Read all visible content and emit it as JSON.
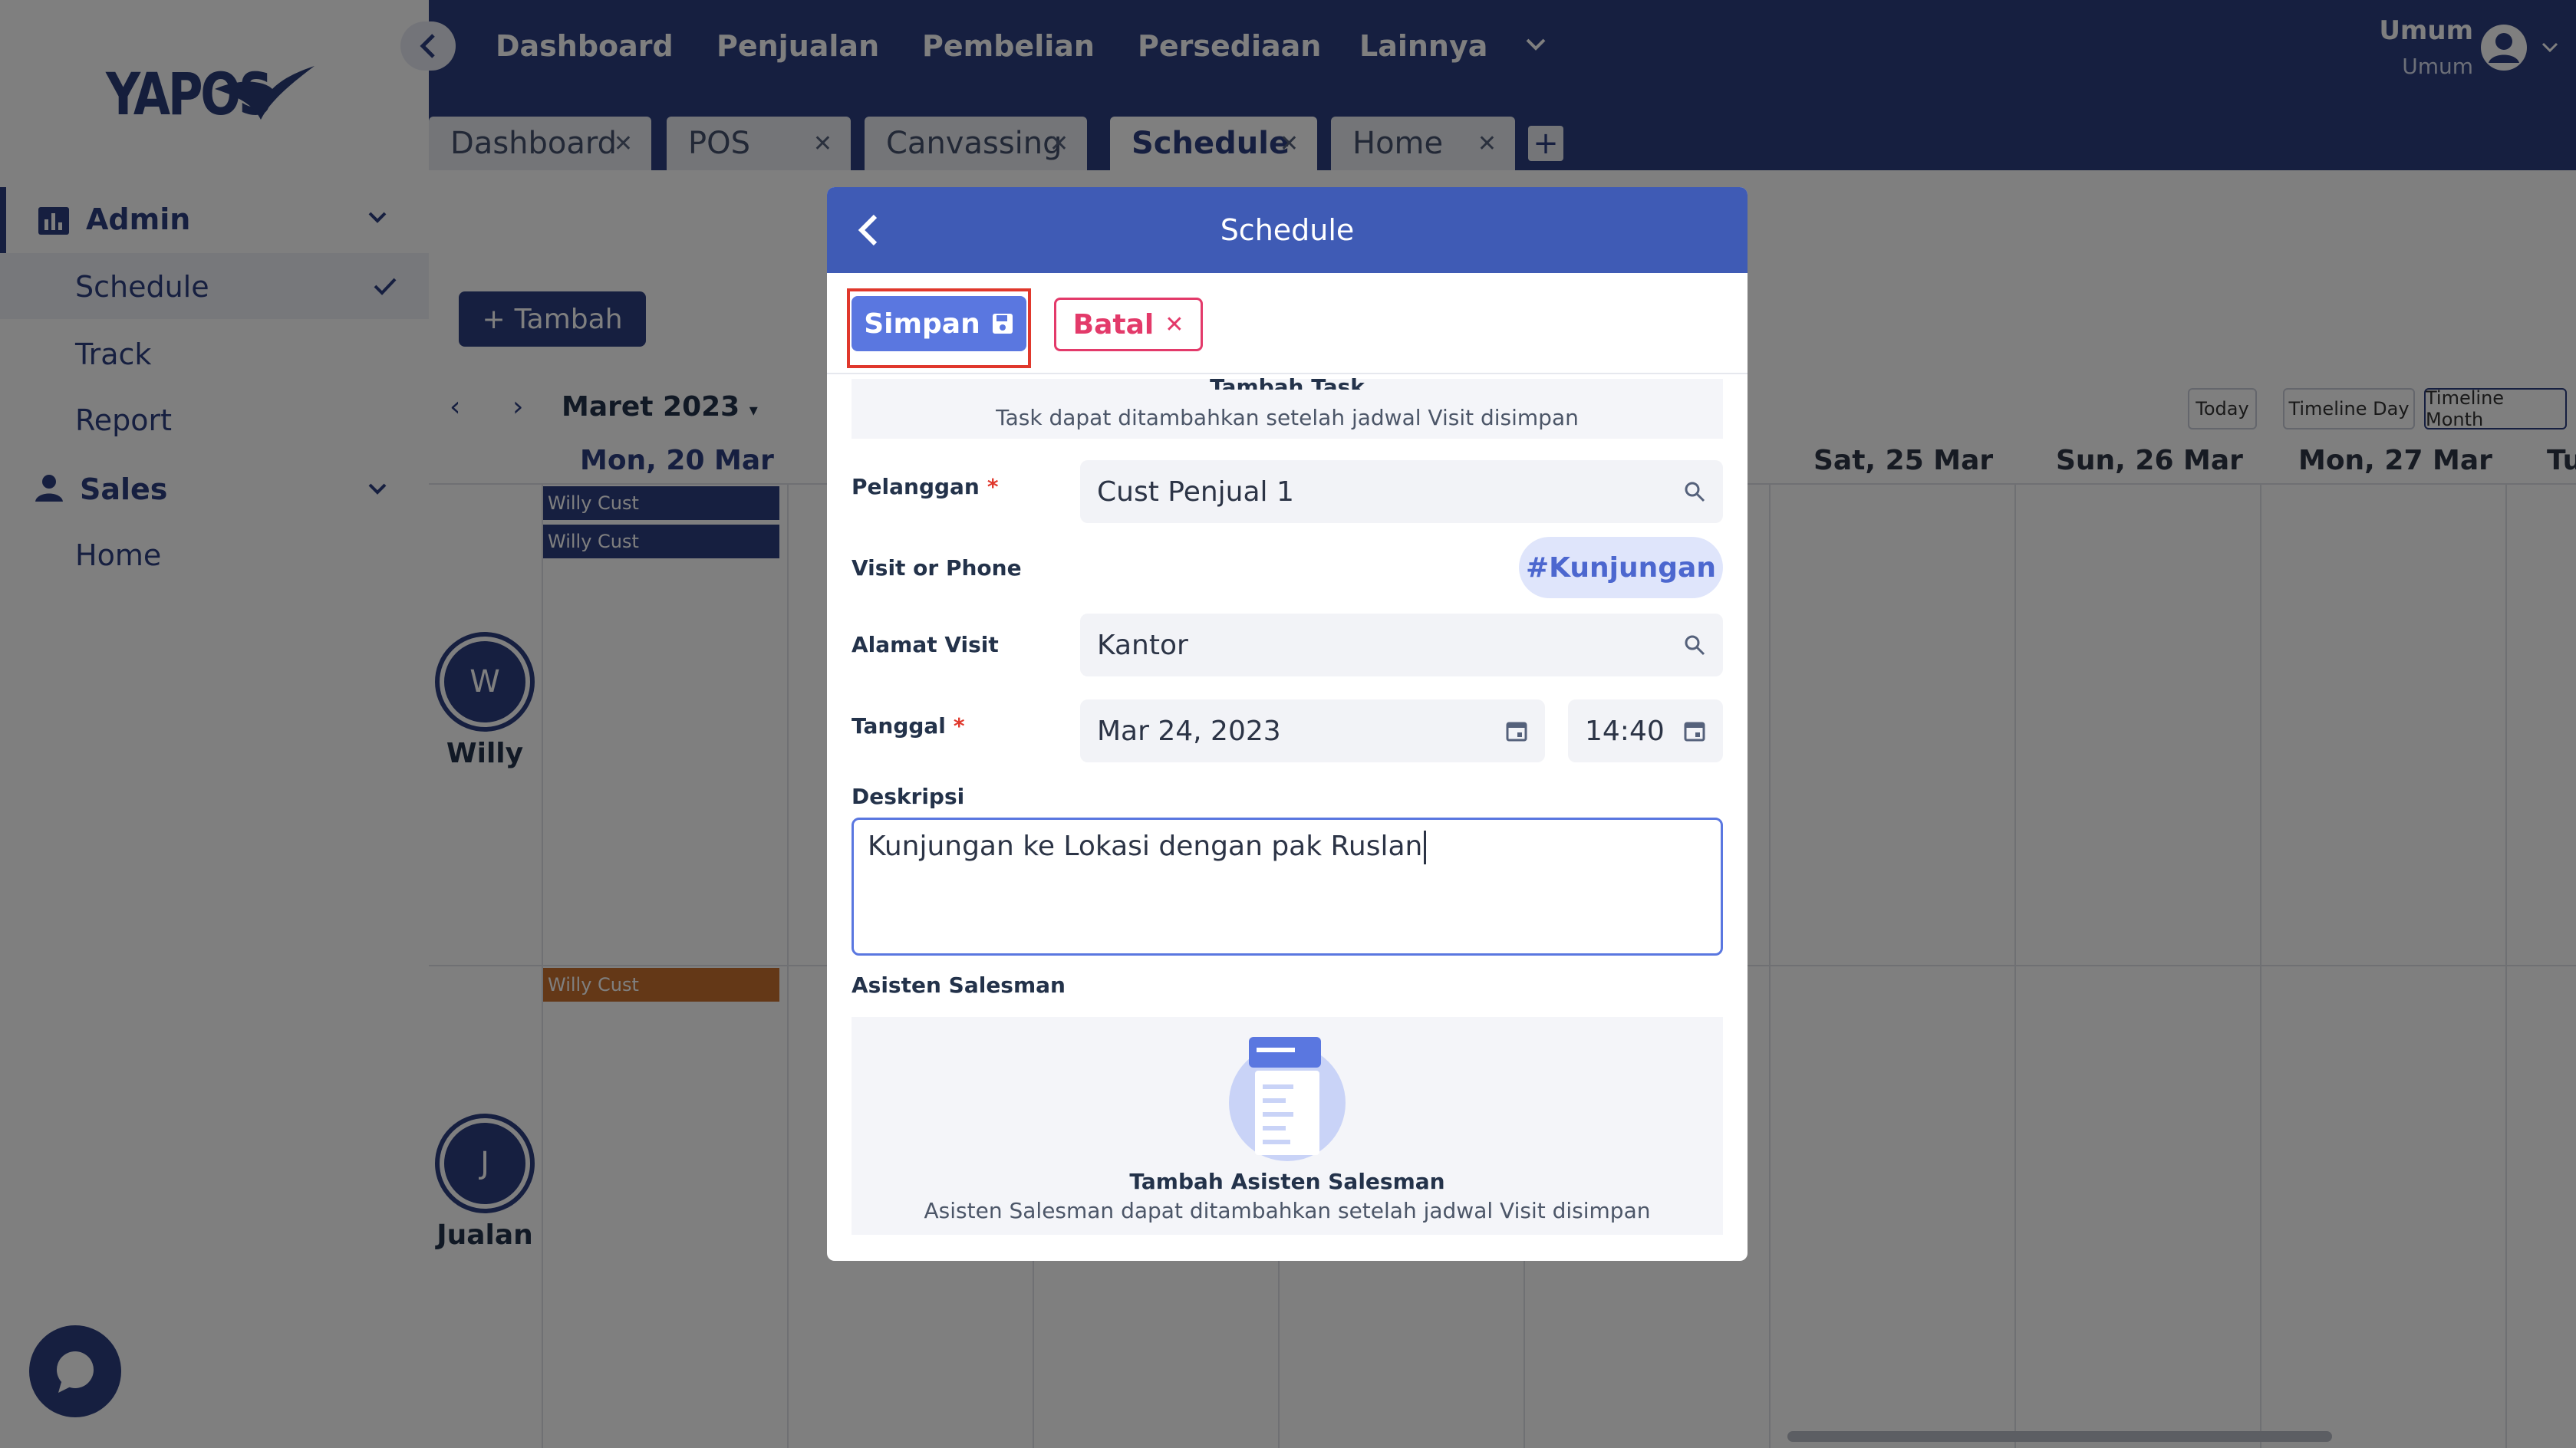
{
  "sidebar": {
    "logo_text": "YAPOS",
    "groups": [
      {
        "label": "Admin",
        "items": [
          "Schedule",
          "Track",
          "Report"
        ]
      },
      {
        "label": "Sales",
        "items": [
          "Home"
        ]
      }
    ],
    "active_item": "Schedule"
  },
  "topbar": {
    "menu": [
      "Dashboard",
      "Penjualan",
      "Pembelian",
      "Persediaan",
      "Lainnya"
    ],
    "user_name": "Umum",
    "user_role": "Umum"
  },
  "tabs": [
    "Dashboard",
    "POS",
    "Canvassing",
    "Schedule",
    "Home"
  ],
  "active_tab": "Schedule",
  "calendar": {
    "add_button": "Tambah",
    "month": "Maret 2023",
    "views": [
      "Today",
      "Timeline Day",
      "Timeline Month"
    ],
    "days": [
      "Mon, 20 Mar",
      "Sat, 25 Mar",
      "Sun, 26 Mar",
      "Mon, 27 Mar",
      "Tu"
    ],
    "events": [
      "Willy Cust",
      "Willy Cust",
      "Willy Cust"
    ],
    "people": [
      {
        "initial": "W",
        "name": "Willy"
      },
      {
        "initial": "J",
        "name": "Jualan"
      }
    ]
  },
  "modal": {
    "title": "Schedule",
    "save_label": "Simpan",
    "cancel_label": "Batal",
    "task_title": "Tambah Task",
    "task_note": "Task dapat ditambahkan setelah jadwal Visit disimpan",
    "fields": {
      "pelanggan_label": "Pelanggan",
      "pelanggan_value": "Cust Penjual 1",
      "visit_label": "Visit or Phone",
      "visit_value": "#Kunjungan",
      "alamat_label": "Alamat Visit",
      "alamat_value": "Kantor",
      "tanggal_label": "Tanggal",
      "tanggal_value": "Mar 24, 2023",
      "time_value": "14:40",
      "deskripsi_label": "Deskripsi",
      "deskripsi_value": "Kunjungan ke Lokasi dengan pak Ruslan",
      "asisten_label": "Asisten Salesman"
    },
    "asisten_title": "Tambah Asisten Salesman",
    "asisten_note": "Asisten Salesman dapat ditambahkan setelah jadwal Visit disimpan"
  },
  "colors": {
    "primary": "#2d3f80",
    "modal_header": "#3f5bb5",
    "save_button": "#5a77e0",
    "cancel": "#e33a6a",
    "highlight": "#e0382c"
  }
}
